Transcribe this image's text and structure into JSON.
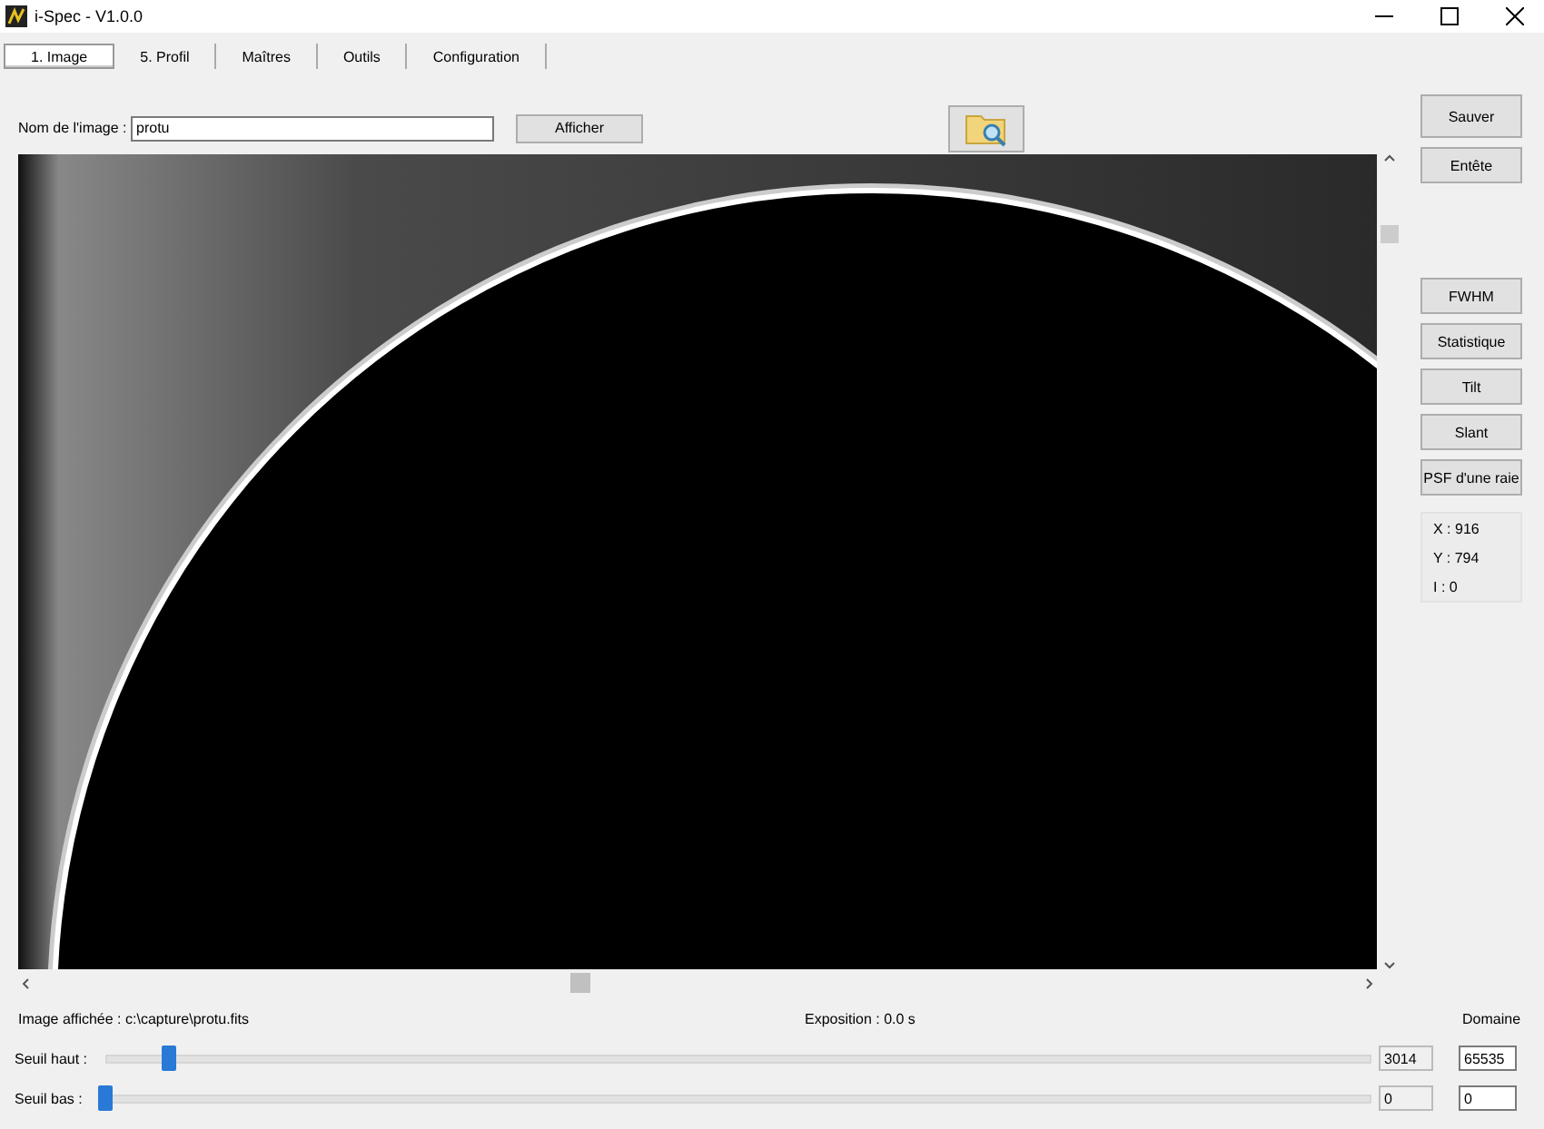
{
  "window": {
    "title": "i-Spec - V1.0.0"
  },
  "tabs": [
    {
      "label": "1. Image",
      "selected": true
    },
    {
      "label": "5. Profil",
      "selected": false
    },
    {
      "label": "Maîtres",
      "selected": false
    },
    {
      "label": "Outils",
      "selected": false
    },
    {
      "label": "Configuration",
      "selected": false
    }
  ],
  "image_name": {
    "label": "Nom de l'image :",
    "value": "protu",
    "button": "Afficher"
  },
  "side_buttons": [
    "Sauver",
    "Entête"
  ],
  "tools": [
    "FWHM",
    "Statistique",
    "Tilt",
    "Slant",
    "PSF d'une raie"
  ],
  "coords": [
    "X : 916",
    "Y : 794",
    "I : 0"
  ],
  "status": {
    "file": "Image affichée : c:\\capture\\protu.fits",
    "exposure": "Exposition : 0.0 s",
    "domain": "Domaine"
  },
  "sliders": [
    {
      "label": "Seuil haut :",
      "level": 0.05,
      "value": "3014",
      "domain": "65535"
    },
    {
      "label": "Seuil bas :",
      "level": 0.0,
      "value": "0",
      "domain": "0"
    }
  ]
}
